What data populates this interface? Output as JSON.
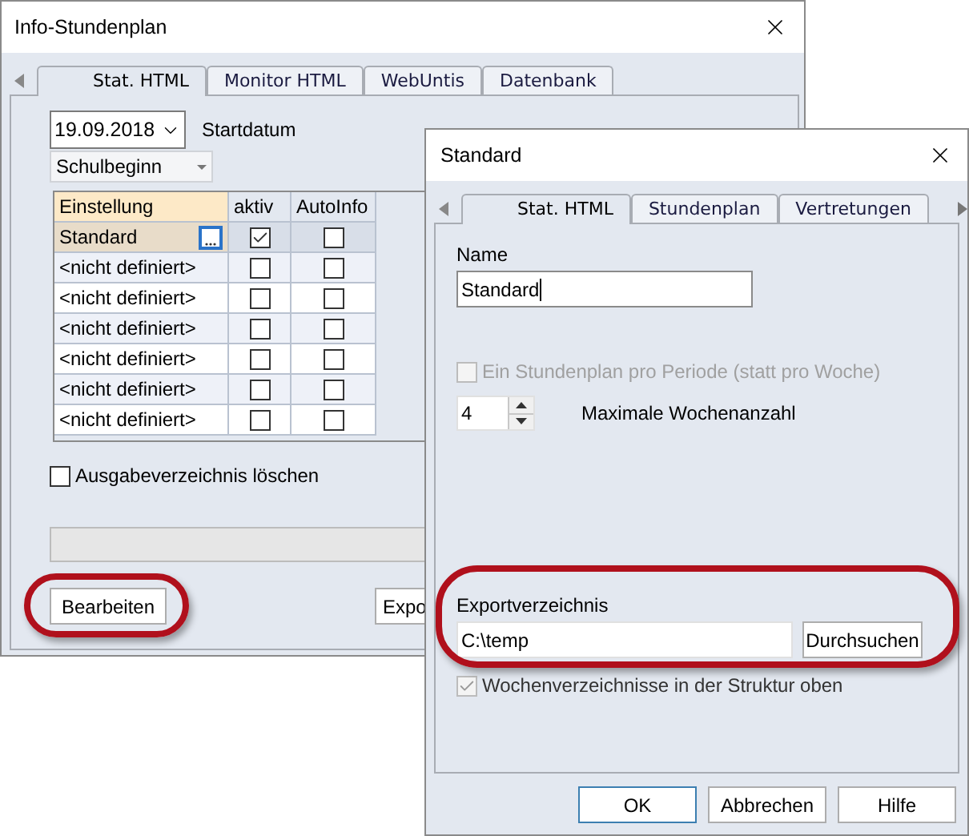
{
  "main_window": {
    "title": "Info-Stundenplan",
    "tabs": [
      {
        "label": "Stat. HTML",
        "selected": true
      },
      {
        "label": "Monitor HTML",
        "selected": false
      },
      {
        "label": "WebUntis",
        "selected": false
      },
      {
        "label": "Datenbank",
        "selected": false
      }
    ],
    "start_date": {
      "value": "19.09.2018",
      "label": "Startdatum"
    },
    "date_mode": {
      "value": "Schulbeginn"
    },
    "table": {
      "columns": [
        "Einstellung",
        "aktiv",
        "AutoInfo"
      ],
      "rows": [
        {
          "name": "Standard",
          "selected": true,
          "aktiv": true,
          "autoinfo": false
        },
        {
          "name": "<nicht definiert>",
          "selected": false,
          "aktiv": false,
          "autoinfo": false
        },
        {
          "name": "<nicht definiert>",
          "selected": false,
          "aktiv": false,
          "autoinfo": false
        },
        {
          "name": "<nicht definiert>",
          "selected": false,
          "aktiv": false,
          "autoinfo": false
        },
        {
          "name": "<nicht definiert>",
          "selected": false,
          "aktiv": false,
          "autoinfo": false
        },
        {
          "name": "<nicht definiert>",
          "selected": false,
          "aktiv": false,
          "autoinfo": false
        },
        {
          "name": "<nicht definiert>",
          "selected": false,
          "aktiv": false,
          "autoinfo": false
        }
      ]
    },
    "clear_output": {
      "label": "Ausgabeverzeichnis löschen",
      "checked": false
    },
    "buttons": [
      {
        "label": "Bearbeiten",
        "highlighted": true
      },
      {
        "label": "Expo",
        "highlighted": false
      }
    ]
  },
  "dialog": {
    "title": "Standard",
    "tabs": [
      {
        "label": "Stat. HTML",
        "selected": true
      },
      {
        "label": "Stundenplan",
        "selected": false
      },
      {
        "label": "Vertretungen",
        "selected": false
      }
    ],
    "name": {
      "label": "Name",
      "value": "Standard"
    },
    "per_period": {
      "label": "Ein Stundenplan pro Periode (statt pro Woche)",
      "checked": false,
      "disabled": true
    },
    "max_weeks": {
      "value": "4",
      "label": "Maximale Wochenanzahl"
    },
    "export": {
      "label": "Exportverzeichnis",
      "value": "C:\\temp",
      "browse": "Durchsuchen",
      "highlighted": true
    },
    "week_dirs": {
      "label": "Wochenverzeichnisse in der Struktur oben",
      "checked": true,
      "disabled": true
    },
    "buttons": [
      {
        "label": "OK",
        "focused": true
      },
      {
        "label": "Abbrechen",
        "focused": false
      },
      {
        "label": "Hilfe",
        "focused": false
      }
    ]
  }
}
